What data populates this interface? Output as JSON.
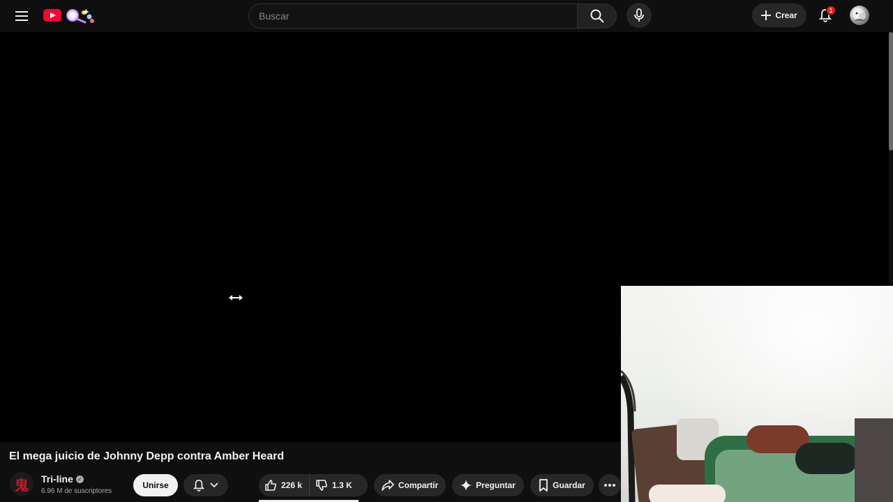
{
  "header": {
    "search_placeholder": "Buscar",
    "create_label": "Crear",
    "notification_count": "1"
  },
  "video": {
    "title": "El mega juicio de Johnny Depp contra Amber Heard"
  },
  "channel": {
    "name": "Tri-line",
    "subscribers": "6.96 M de suscriptores",
    "avatar_glyph": "鬼",
    "join_label": "Unirse"
  },
  "actions": {
    "likes": "226 k",
    "dislikes": "1.3 K",
    "share_label": "Compartir",
    "ask_label": "Preguntar",
    "save_label": "Guardar"
  },
  "colors": {
    "background": "#0f0f0f",
    "brand_red": "#ff0033",
    "pill_bg": "#272727"
  },
  "icons": [
    "menu-icon",
    "youtube-logo-icon",
    "search-icon",
    "mic-icon",
    "plus-icon",
    "bell-icon",
    "thumbs-up-icon",
    "thumbs-down-icon",
    "share-icon",
    "sparkle-icon",
    "bookmark-icon",
    "more-icon",
    "chevron-down-icon",
    "resize-cursor-icon"
  ]
}
